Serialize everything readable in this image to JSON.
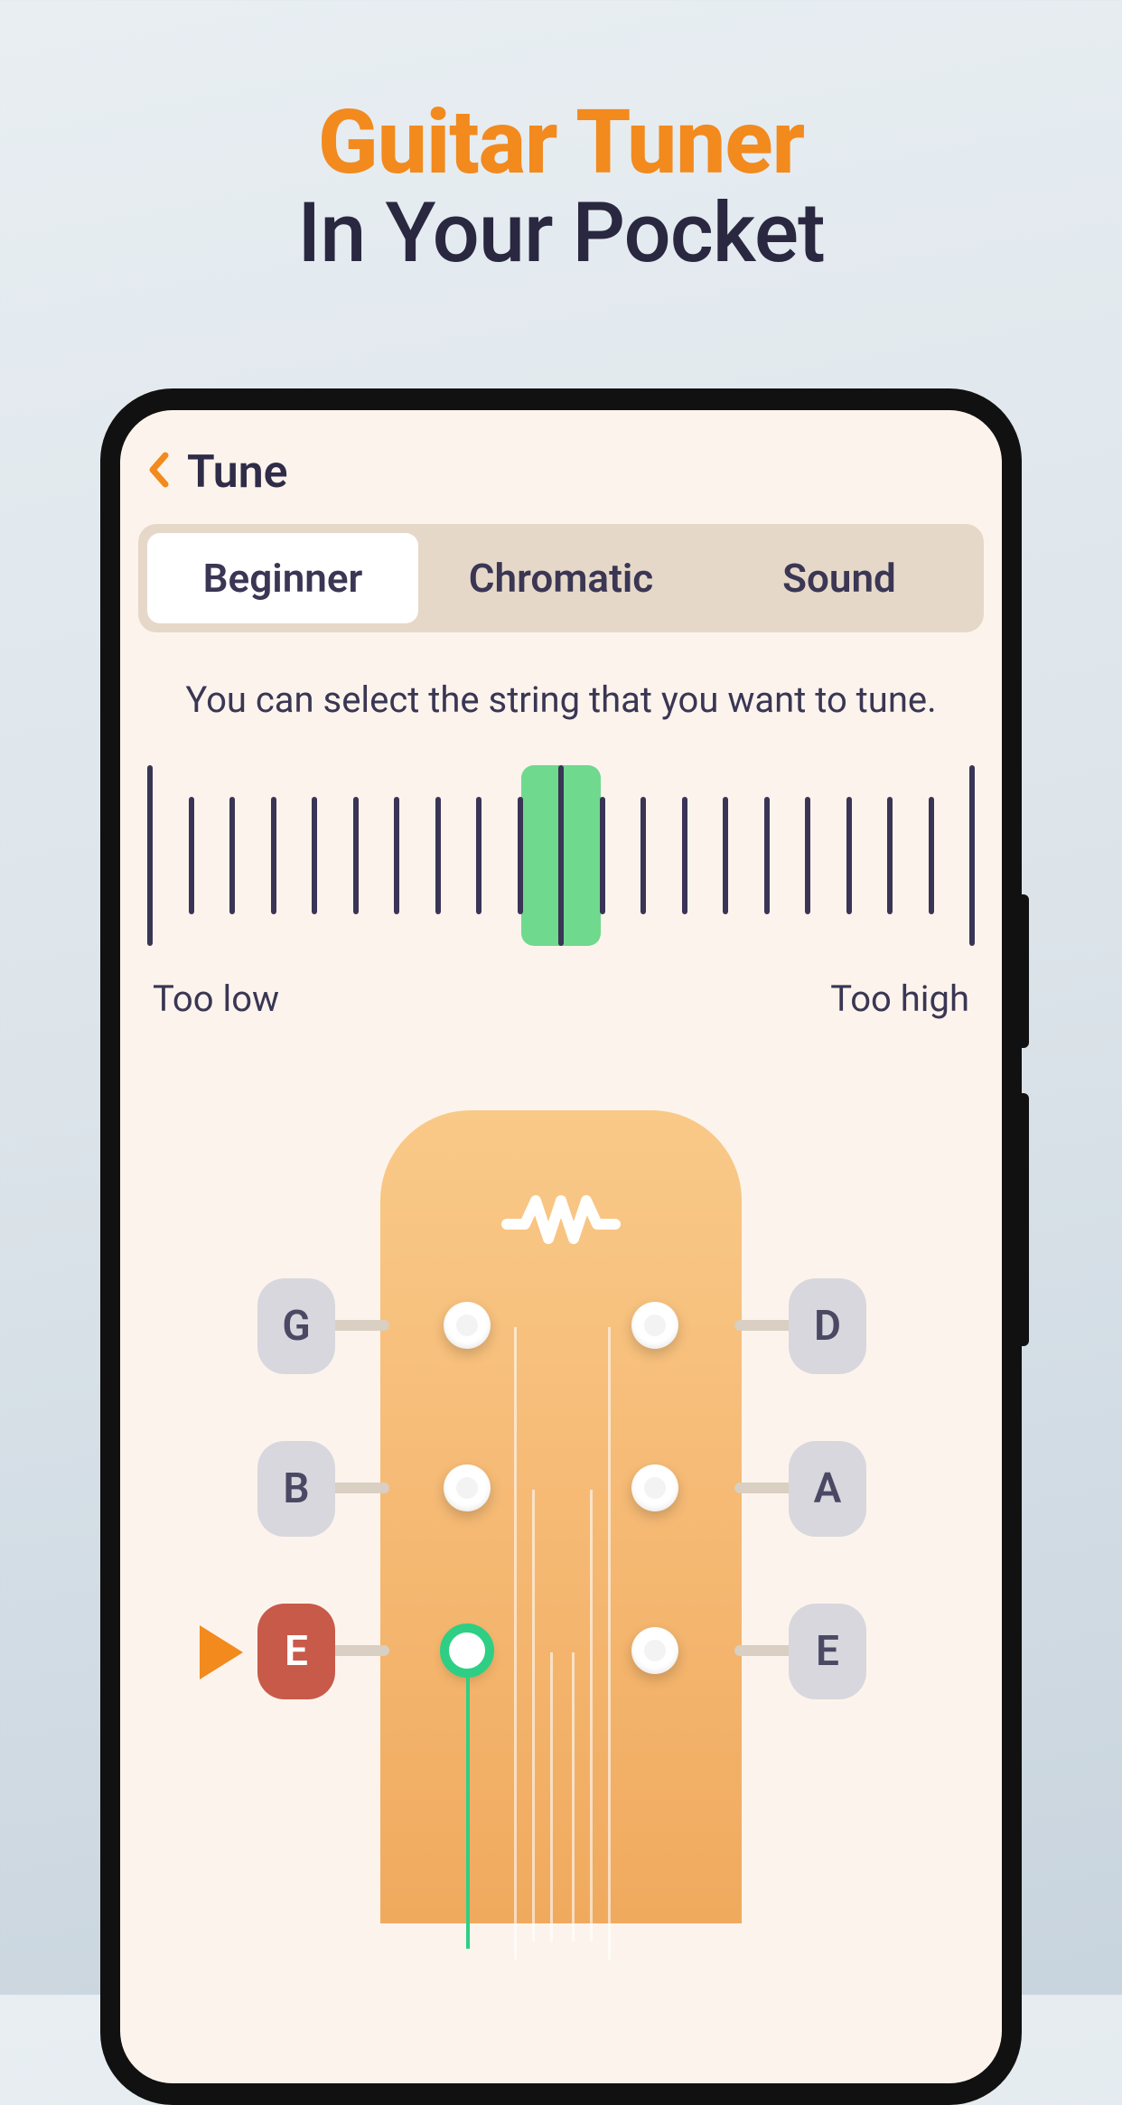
{
  "promo": {
    "line1": "Guitar Tuner",
    "line2": "In Your Pocket"
  },
  "header": {
    "title": "Tune"
  },
  "tabs": {
    "items": [
      {
        "label": "Beginner",
        "active": true
      },
      {
        "label": "Chromatic",
        "active": false
      },
      {
        "label": "Sound",
        "active": false
      }
    ]
  },
  "hint": "You can select the string that you want to tune.",
  "meter": {
    "low_label": "Too low",
    "high_label": "Too high"
  },
  "strings": {
    "left": [
      {
        "label": "G",
        "active": false
      },
      {
        "label": "B",
        "active": false
      },
      {
        "label": "E",
        "active": true
      }
    ],
    "right": [
      {
        "label": "D",
        "active": false
      },
      {
        "label": "A",
        "active": false
      },
      {
        "label": "E",
        "active": false
      }
    ]
  }
}
